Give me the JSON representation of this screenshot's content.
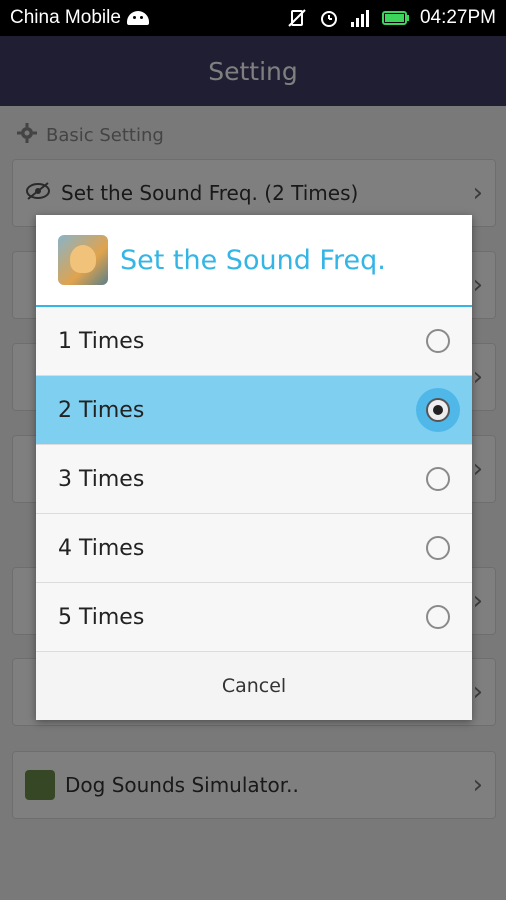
{
  "status_bar": {
    "carrier": "China Mobile",
    "time": "04:27PM"
  },
  "titlebar": {
    "title": "Setting"
  },
  "background": {
    "section_basic": "Basic Setting",
    "row_sound_freq": "Set the Sound Freq. (2 Times)",
    "row_dog": "Dog Sounds Simulator.."
  },
  "dialog": {
    "title": "Set the Sound Freq.",
    "options": [
      "1 Times",
      "2 Times",
      "3 Times",
      "4 Times",
      "5 Times"
    ],
    "selected_index": 1,
    "cancel_label": "Cancel"
  },
  "colors": {
    "accent": "#33b5e5",
    "title_bar": "#3f3c66",
    "selected_row": "#7fcff0"
  }
}
